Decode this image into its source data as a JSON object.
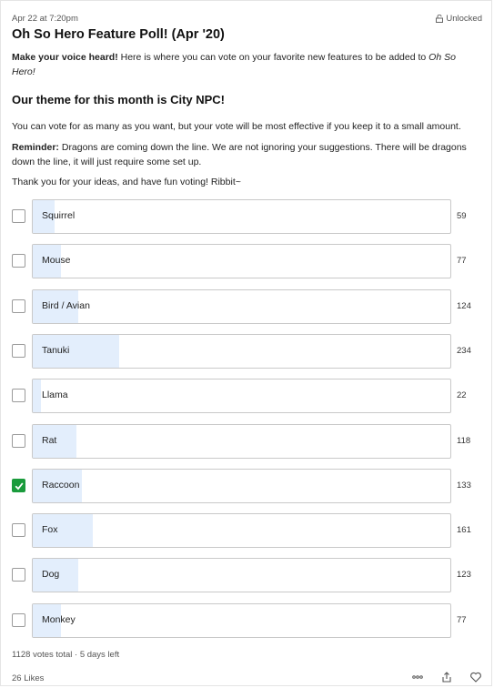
{
  "post": {
    "date": "Apr 22 at 7:20pm",
    "lock_label": "Unlocked",
    "title": "Oh So Hero Feature Poll! (Apr '20)",
    "intro_bold": "Make your voice heard!",
    "intro_text": " Here is where you can vote on your favorite new features to be added to ",
    "intro_italic": "Oh So Hero!",
    "theme": "Our theme for this month is City NPC!",
    "vote_note": "You can vote for as many as you want, but your vote will be most effective if you keep it to a small amount.",
    "reminder_bold": "Reminder:",
    "reminder_text": " Dragons are coming down the line. We are not ignoring your suggestions. There will be  dragons down the line, it will just require some set up.",
    "thanks": "Thank you for your ideas, and have fun voting! Ribbit~"
  },
  "poll": {
    "options": [
      {
        "label": "Squirrel",
        "count": "59",
        "votes": 59,
        "checked": false
      },
      {
        "label": "Mouse",
        "count": "77",
        "votes": 77,
        "checked": false
      },
      {
        "label": "Bird / Avian",
        "count": "124",
        "votes": 124,
        "checked": false
      },
      {
        "label": "Tanuki",
        "count": "234",
        "votes": 234,
        "checked": false
      },
      {
        "label": "Llama",
        "count": "22",
        "votes": 22,
        "checked": false
      },
      {
        "label": "Rat",
        "count": "118",
        "votes": 118,
        "checked": false
      },
      {
        "label": "Raccoon",
        "count": "133",
        "votes": 133,
        "checked": true
      },
      {
        "label": "Fox",
        "count": "161",
        "votes": 161,
        "checked": false
      },
      {
        "label": "Dog",
        "count": "123",
        "votes": 123,
        "checked": false
      },
      {
        "label": "Monkey",
        "count": "77",
        "votes": 77,
        "checked": false
      }
    ],
    "total_votes": 1128,
    "footer": "1128 votes total · 5 days left"
  },
  "footer": {
    "likes": "26 Likes",
    "icons": [
      "more-options-icon",
      "share-icon",
      "heart-icon"
    ]
  },
  "colors": {
    "bar_fill": "#e3eefc",
    "checked": "#1a9b3c"
  }
}
